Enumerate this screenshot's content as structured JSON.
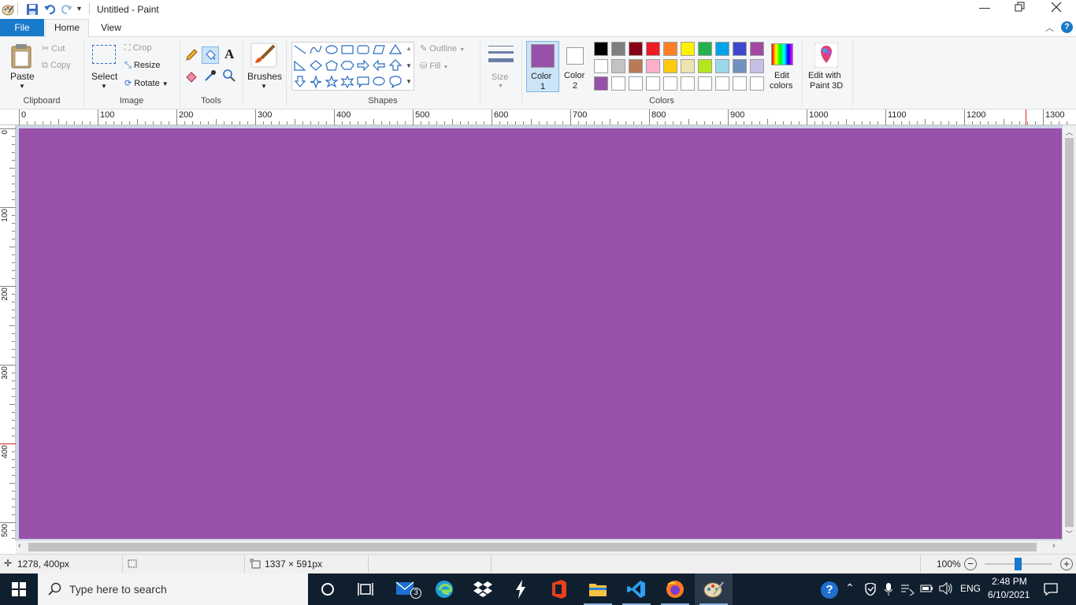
{
  "titlebar": {
    "title": "Untitled - Paint"
  },
  "tabs": [
    {
      "label": "File"
    },
    {
      "label": "Home"
    },
    {
      "label": "View"
    }
  ],
  "ribbon": {
    "clipboard": {
      "paste": "Paste",
      "cut": "Cut",
      "copy": "Copy",
      "group": "Clipboard"
    },
    "image": {
      "select": "Select",
      "crop": "Crop",
      "resize": "Resize",
      "rotate": "Rotate",
      "group": "Image"
    },
    "tools": {
      "group": "Tools"
    },
    "brushes": {
      "label": "Brushes"
    },
    "shapes": {
      "outline": "Outline",
      "fill": "Fill",
      "group": "Shapes"
    },
    "size": {
      "label": "Size"
    },
    "colors": {
      "color1_line1": "Color",
      "color1_line2": "1",
      "color2_line1": "Color",
      "color2_line2": "2",
      "edit_line1": "Edit",
      "edit_line2": "colors",
      "group": "Colors",
      "color1": "#9751a8",
      "color2": "#ffffff",
      "row1": [
        "#000000",
        "#7f7f7f",
        "#880015",
        "#ed1c24",
        "#ff7f27",
        "#fff200",
        "#22b14c",
        "#00a2e8",
        "#3f48cc",
        "#a349a4"
      ],
      "row2": [
        "#ffffff",
        "#c3c3c3",
        "#b97a57",
        "#ffaec9",
        "#ffc90e",
        "#efe4b0",
        "#b5e61d",
        "#99d9ea",
        "#7092be",
        "#c8bfe7"
      ],
      "row3": [
        "#9751a8",
        "#ffffff",
        "#ffffff",
        "#ffffff",
        "#ffffff",
        "#ffffff",
        "#ffffff",
        "#ffffff",
        "#ffffff",
        "#ffffff"
      ]
    },
    "paint3d": {
      "line1": "Edit with",
      "line2": "Paint 3D"
    }
  },
  "rulers": {
    "h_labels": [
      "0",
      "100",
      "200",
      "300",
      "400",
      "500",
      "600",
      "700",
      "800",
      "900",
      "1000",
      "1100",
      "1200",
      "1300"
    ],
    "v_labels": [
      "0",
      "100",
      "200",
      "300",
      "400",
      "500"
    ]
  },
  "canvas": {
    "fill": "#9751a8"
  },
  "status": {
    "cursor_pos": "1278, 400px",
    "image_size": "1337 × 591px",
    "zoom": "100%",
    "zoom_value": 100
  },
  "taskbar": {
    "search_placeholder": "Type here to search",
    "mail_badge": "3",
    "language": "ENG",
    "time": "2:48 PM",
    "date": "6/10/2021"
  }
}
